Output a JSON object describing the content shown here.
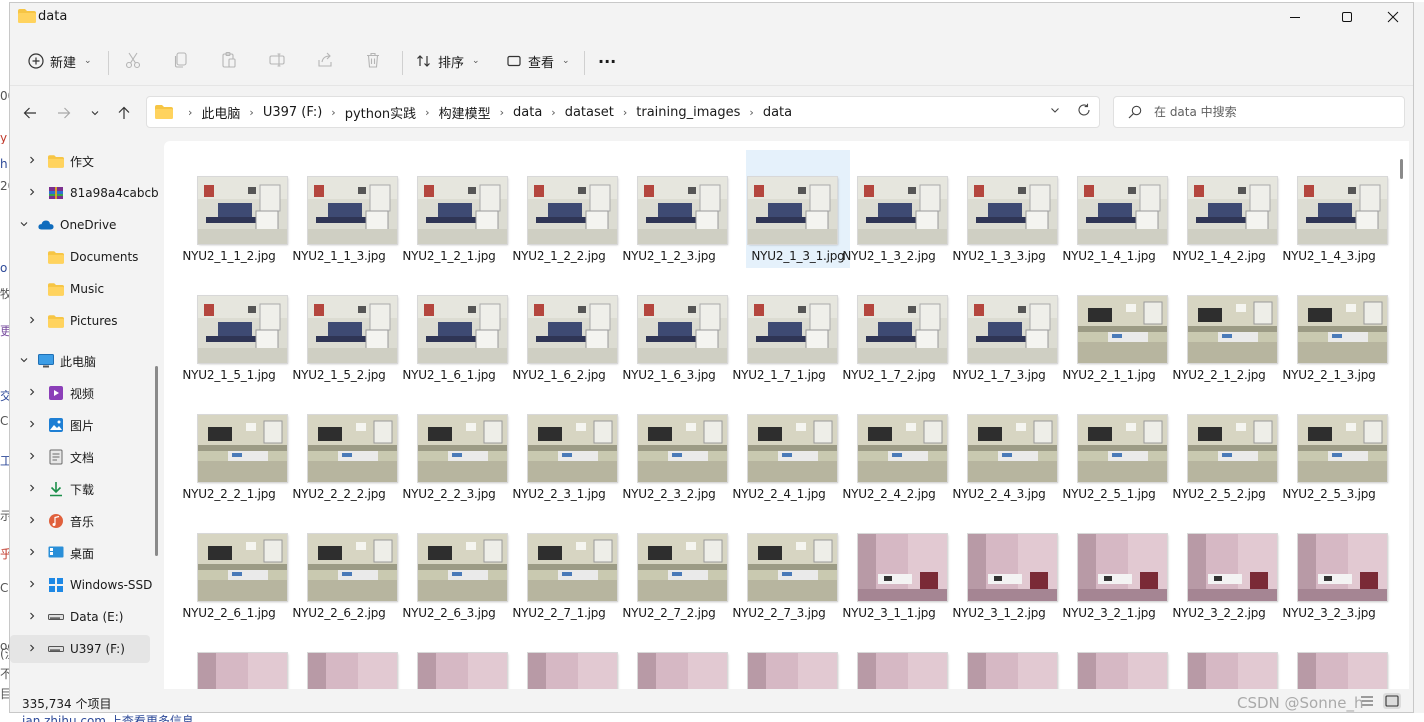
{
  "window": {
    "title": "data"
  },
  "toolbar": {
    "new_label": "新建",
    "sort_label": "排序",
    "view_label": "查看",
    "more_label": "···"
  },
  "address": {
    "crumbs": [
      "此电脑",
      "U397 (F:)",
      "python实践",
      "构建模型",
      "data",
      "dataset",
      "training_images",
      "data"
    ]
  },
  "search": {
    "placeholder": "在 data 中搜索"
  },
  "sidebar": {
    "items": [
      {
        "label": "作文",
        "icon": "folder-icon",
        "chevron": ">"
      },
      {
        "label": "81a98a4cabcb",
        "icon": "archive-icon",
        "chevron": ">"
      },
      {
        "label": "OneDrive",
        "icon": "cloud-icon",
        "chevron": "v"
      },
      {
        "label": "Documents",
        "icon": "folder-icon",
        "chevron": ""
      },
      {
        "label": "Music",
        "icon": "folder-icon",
        "chevron": ""
      },
      {
        "label": "Pictures",
        "icon": "folder-icon",
        "chevron": ">"
      },
      {
        "label": "此电脑",
        "icon": "pc-icon",
        "chevron": "v"
      },
      {
        "label": "视频",
        "icon": "video-icon",
        "chevron": ">"
      },
      {
        "label": "图片",
        "icon": "picture-icon",
        "chevron": ">"
      },
      {
        "label": "文档",
        "icon": "document-icon",
        "chevron": ">"
      },
      {
        "label": "下载",
        "icon": "download-icon",
        "chevron": ">"
      },
      {
        "label": "音乐",
        "icon": "music-icon",
        "chevron": ">"
      },
      {
        "label": "桌面",
        "icon": "desktop-icon",
        "chevron": ">"
      },
      {
        "label": "Windows-SSD",
        "icon": "drive-windows-icon",
        "chevron": ">"
      },
      {
        "label": "Data (E:)",
        "icon": "drive-icon",
        "chevron": ">"
      },
      {
        "label": "U397 (F:)",
        "icon": "drive-icon",
        "chevron": ">"
      }
    ]
  },
  "files": [
    "NYU2_1_1_2.jpg",
    "NYU2_1_1_3.jpg",
    "NYU2_1_2_1.jpg",
    "NYU2_1_2_2.jpg",
    "NYU2_1_2_3.jpg",
    "NYU2_1_3_1.jpg",
    "NYU2_1_3_2.jpg",
    "NYU2_1_3_3.jpg",
    "NYU2_1_4_1.jpg",
    "NYU2_1_4_2.jpg",
    "NYU2_1_4_3.jpg",
    "NYU2_1_5_1.jpg",
    "NYU2_1_5_2.jpg",
    "NYU2_1_6_1.jpg",
    "NYU2_1_6_2.jpg",
    "NYU2_1_6_3.jpg",
    "NYU2_1_7_1.jpg",
    "NYU2_1_7_2.jpg",
    "NYU2_1_7_3.jpg",
    "NYU2_2_1_1.jpg",
    "NYU2_2_1_2.jpg",
    "NYU2_2_1_3.jpg",
    "NYU2_2_2_1.jpg",
    "NYU2_2_2_2.jpg",
    "NYU2_2_2_3.jpg",
    "NYU2_2_3_1.jpg",
    "NYU2_2_3_2.jpg",
    "NYU2_2_4_1.jpg",
    "NYU2_2_4_2.jpg",
    "NYU2_2_4_3.jpg",
    "NYU2_2_5_1.jpg",
    "NYU2_2_5_2.jpg",
    "NYU2_2_5_3.jpg",
    "NYU2_2_6_1.jpg",
    "NYU2_2_6_2.jpg",
    "NYU2_2_6_3.jpg",
    "NYU2_2_7_1.jpg",
    "NYU2_2_7_2.jpg",
    "NYU2_2_7_3.jpg",
    "NYU2_3_1_1.jpg",
    "NYU2_3_1_2.jpg",
    "NYU2_3_2_1.jpg",
    "NYU2_3_2_2.jpg",
    "NYU2_3_2_3.jpg"
  ],
  "file_scenes": [
    "room-a",
    "room-a",
    "room-a",
    "room-a",
    "room-a",
    "room-a",
    "room-a",
    "room-a",
    "room-a",
    "room-a",
    "room-a",
    "room-a",
    "room-a",
    "room-a",
    "room-a",
    "room-a",
    "room-a",
    "room-a",
    "room-a",
    "room-b",
    "room-b",
    "room-b",
    "room-b",
    "room-b",
    "room-b",
    "room-b",
    "room-b",
    "room-b",
    "room-b",
    "room-b",
    "room-b",
    "room-b",
    "room-b",
    "room-b",
    "room-b",
    "room-b",
    "room-b",
    "room-b",
    "room-b",
    "room-c",
    "room-c",
    "room-c",
    "room-c",
    "room-c",
    "room-c",
    "room-c",
    "room-c",
    "room-c",
    "room-c",
    "room-c",
    "room-c",
    "room-c",
    "room-c",
    "room-c",
    "room-c"
  ],
  "selected_file": "NYU2_1_3_1.jpg",
  "status": {
    "count": "335,734 个项目"
  },
  "background_page": {
    "bottom_text": "ian.zhihu.com 上查看更多信息",
    "left_fragments": [
      "00",
      "y",
      "h",
      "20",
      "o",
      "牧",
      "更",
      "交",
      "C",
      "工",
      "示",
      "乎",
      "C",
      "oc",
      "(注",
      "不",
      "目"
    ]
  },
  "watermark": "CSDN @Sonne_h",
  "colors": {
    "accent": "#0067c0",
    "folder": "#f6c544",
    "selection": "#e5f1fb",
    "room_a_wall": "#dcdcd2",
    "room_b_wall": "#c9c9b0",
    "room_c_wall": "#d6b8c4"
  }
}
